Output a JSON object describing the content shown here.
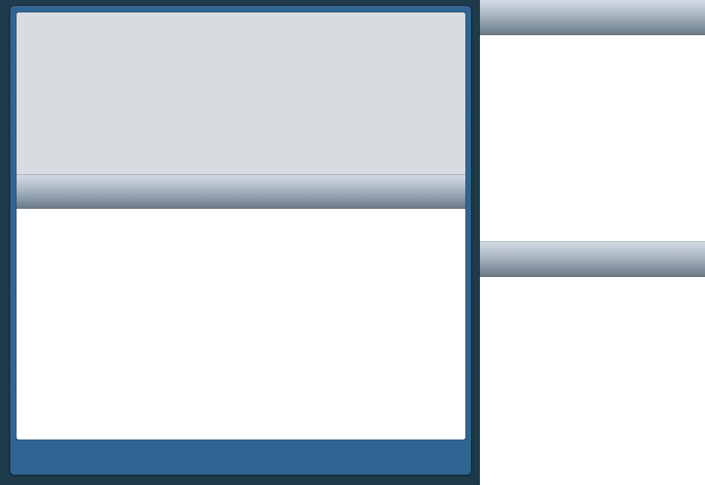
{
  "popover": {
    "top_region_text": "",
    "header_title": "",
    "list_items": [],
    "toolbar_text": ""
  },
  "detail_pane": {
    "top_header_title": "",
    "top_list_items": [],
    "middle_header_title": "",
    "bottom_list_items": []
  },
  "colors": {
    "background": "#1d3a4c",
    "popover_frame": "#2f6592",
    "top_region": "#d8dbe0",
    "header_gradient_light": "#d3dbe4",
    "header_gradient_dark": "#6c7b86",
    "content": "#ffffff"
  }
}
